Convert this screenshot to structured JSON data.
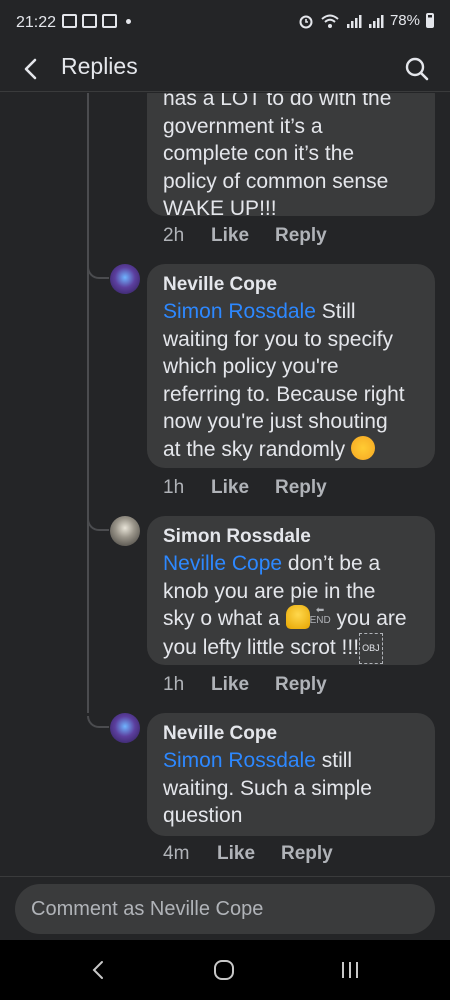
{
  "status_bar": {
    "time": "21:22",
    "battery": "78%"
  },
  "header": {
    "title": "Replies"
  },
  "comments": [
    {
      "author": "",
      "mention": "",
      "text_lines": [
        "nas a LOT to do with the",
        "government it’s a",
        "complete con it’s the",
        "policy of common sense",
        "WAKE UP!!!"
      ],
      "time": "2h",
      "like": "Like",
      "reply": "Reply"
    },
    {
      "author": "Neville Cope",
      "mention": "Simon Rossdale",
      "text_after_mention": " Still",
      "text_lines": [
        "waiting for you to specify",
        "which policy you're",
        "referring to. Because right",
        "now you're just shouting",
        "at the sky randomly "
      ],
      "emoji": "rolling-laughing-emoji",
      "time": "1h",
      "like": "Like",
      "reply": "Reply"
    },
    {
      "author": "Simon Rossdale",
      "mention": "Neville Cope",
      "text_after_mention": " don’t be a",
      "text_lines": [
        "knob you are pie in the",
        "sky o what a ",
        " you are",
        "you lefty little scrot !!!"
      ],
      "emoji": "bell-emoji",
      "end_glyph": "END",
      "obj_glyph": "OBJ",
      "time": "1h",
      "like": "Like",
      "reply": "Reply"
    },
    {
      "author": "Neville Cope",
      "mention": "Simon Rossdale",
      "text_after_mention": " still",
      "text_lines": [
        "waiting. Such a simple",
        "question"
      ],
      "time": "4m",
      "like": "Like",
      "reply": "Reply"
    }
  ],
  "composer": {
    "placeholder": "Comment as Neville Cope"
  }
}
